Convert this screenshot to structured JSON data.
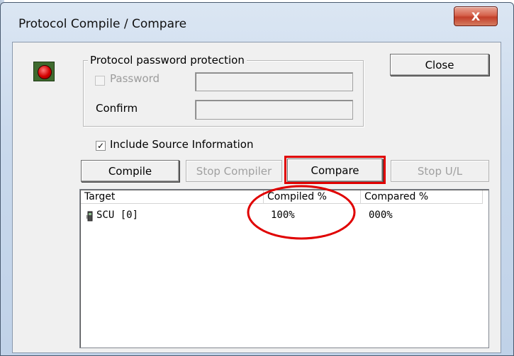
{
  "window": {
    "title": "Protocol Compile / Compare",
    "close_glyph": "X"
  },
  "protection_group": {
    "label": "Protocol password protection",
    "password_checkbox_label": "Password",
    "password_checked": false,
    "password_value": "",
    "confirm_label": "Confirm",
    "confirm_value": ""
  },
  "include_source": {
    "label": "Include Source Information",
    "checked": true,
    "check_glyph": "✓"
  },
  "buttons": {
    "close": "Close",
    "compile": "Compile",
    "stop_compiler": "Stop Compiler",
    "compare": "Compare",
    "stop_ul": "Stop U/L"
  },
  "table": {
    "columns": [
      "Target",
      "Compiled %",
      "Compared %"
    ],
    "rows": [
      {
        "target": "SCU [0]",
        "compiled": "100%",
        "compared": "000%"
      }
    ]
  },
  "icons": {
    "status_led": "red-led-icon",
    "device": "device-icon"
  },
  "colors": {
    "annotation_red": "#e00000",
    "close_button_red": "#c3402b"
  }
}
